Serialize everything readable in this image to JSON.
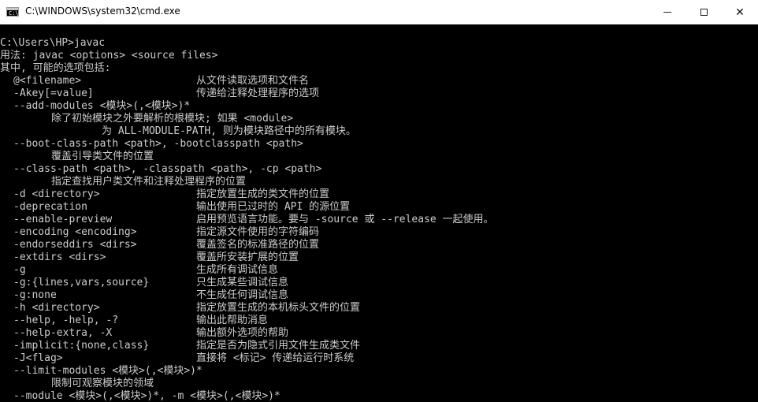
{
  "window": {
    "icon": "cmd-icon",
    "title": "C:\\WINDOWS\\system32\\cmd.exe",
    "minimize_symbol": "–",
    "maximize_symbol": "□",
    "close_symbol": "✕"
  },
  "console": {
    "prompt_line": "C:\\Users\\HP>javac",
    "usage_line": "用法: javac <options> <source files>",
    "intro_line": "其中, 可能的选项包括:",
    "options": [
      {
        "option": "@<filename>",
        "desc": "从文件读取选项和文件名"
      },
      {
        "option": "-Akey[=value]",
        "desc": "传递给注释处理程序的选项"
      },
      {
        "option": "--add-modules <模块>(,<模块>)*",
        "desc": ""
      },
      {
        "option": "",
        "desc": "",
        "wrap1": "除了初始模块之外要解析的根模块; 如果 <module>"
      },
      {
        "option": "",
        "desc": "",
        "wrap2": "为 ALL-MODULE-PATH, 则为模块路径中的所有模块。"
      },
      {
        "option": "--boot-class-path <path>, -bootclasspath <path>",
        "desc": ""
      },
      {
        "option": "",
        "desc": "",
        "wrap1": "覆盖引导类文件的位置"
      },
      {
        "option": "--class-path <path>, -classpath <path>, -cp <path>",
        "desc": ""
      },
      {
        "option": "",
        "desc": "",
        "wrap1": "指定查找用户类文件和注释处理程序的位置"
      },
      {
        "option": "-d <directory>",
        "desc": "指定放置生成的类文件的位置"
      },
      {
        "option": "-deprecation",
        "desc": "输出使用已过时的 API 的源位置"
      },
      {
        "option": "--enable-preview",
        "desc": "启用预览语言功能。要与 -source 或 --release 一起使用。"
      },
      {
        "option": "-encoding <encoding>",
        "desc": "指定源文件使用的字符编码"
      },
      {
        "option": "-endorseddirs <dirs>",
        "desc": "覆盖签名的标准路径的位置"
      },
      {
        "option": "-extdirs <dirs>",
        "desc": "覆盖所安装扩展的位置"
      },
      {
        "option": "-g",
        "desc": "生成所有调试信息"
      },
      {
        "option": "-g:{lines,vars,source}",
        "desc": "只生成某些调试信息"
      },
      {
        "option": "-g:none",
        "desc": "不生成任何调试信息"
      },
      {
        "option": "-h <directory>",
        "desc": "指定放置生成的本机标头文件的位置"
      },
      {
        "option": "--help, -help, -?",
        "desc": "输出此帮助消息"
      },
      {
        "option": "--help-extra, -X",
        "desc": "输出额外选项的帮助"
      },
      {
        "option": "-implicit:{none,class}",
        "desc": "指定是否为隐式引用文件生成类文件"
      },
      {
        "option": "-J<flag>",
        "desc": "直接将 <标记> 传递给运行时系统"
      },
      {
        "option": "--limit-modules <模块>(,<模块>)*",
        "desc": ""
      },
      {
        "option": "",
        "desc": "",
        "wrap1": "限制可观察模块的领域"
      },
      {
        "option": "--module <模块>(,<模块>)*, -m <模块>(,<模块>)*",
        "desc": ""
      }
    ]
  }
}
